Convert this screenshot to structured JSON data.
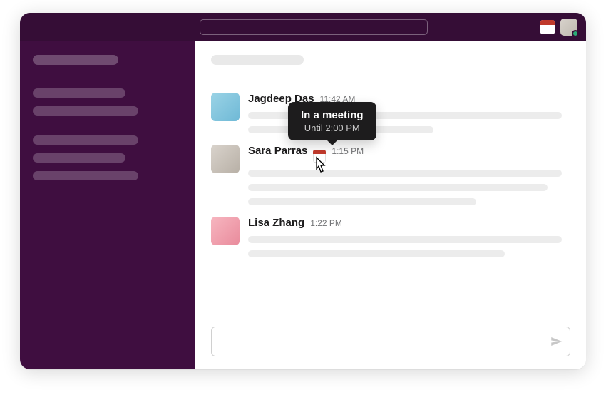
{
  "topbar": {
    "header_status_icon": "calendar-icon"
  },
  "tooltip": {
    "title": "In a meeting",
    "subtitle": "Until 2:00 PM"
  },
  "messages": [
    {
      "sender": "Jagdeep Das",
      "time": "11:42 AM"
    },
    {
      "sender": "Sara Parras",
      "time": "1:15 PM",
      "status_icon": "calendar-icon"
    },
    {
      "sender": "Lisa Zhang",
      "time": "1:22 PM"
    }
  ]
}
